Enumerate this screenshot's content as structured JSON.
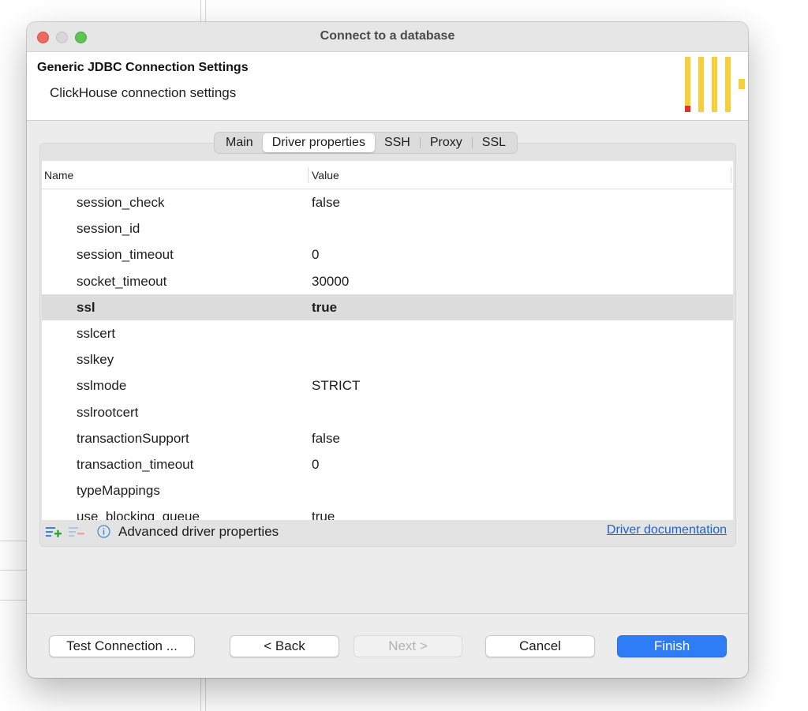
{
  "window": {
    "title": "Connect to a database"
  },
  "header": {
    "title": "Generic JDBC Connection Settings",
    "subtitle": "ClickHouse connection settings",
    "logo_icon": "clickhouse-logo",
    "logo_color": "#f5cf3c",
    "logo_accent": "#e2302c"
  },
  "tabs": [
    {
      "label": "Main",
      "active": false
    },
    {
      "label": "Driver properties",
      "active": true
    },
    {
      "label": "SSH",
      "active": false
    },
    {
      "label": "Proxy",
      "active": false
    },
    {
      "label": "SSL",
      "active": false
    }
  ],
  "table": {
    "columns": [
      "Name",
      "Value"
    ],
    "rows": [
      {
        "name": "session_check",
        "value": "false"
      },
      {
        "name": "session_id",
        "value": ""
      },
      {
        "name": "session_timeout",
        "value": "0"
      },
      {
        "name": "socket_timeout",
        "value": "30000"
      },
      {
        "name": "ssl",
        "value": "true"
      },
      {
        "name": "sslcert",
        "value": ""
      },
      {
        "name": "sslkey",
        "value": ""
      },
      {
        "name": "sslmode",
        "value": "STRICT"
      },
      {
        "name": "sslrootcert",
        "value": ""
      },
      {
        "name": "transactionSupport",
        "value": "false"
      },
      {
        "name": "transaction_timeout",
        "value": "0"
      },
      {
        "name": "typeMappings",
        "value": ""
      },
      {
        "name": "use_blocking_queue",
        "value": "true"
      }
    ],
    "selected_row": "ssl"
  },
  "properties_footer": {
    "add_icon": "add-property-icon",
    "remove_icon": "remove-property-icon",
    "info_icon": "info-icon",
    "advanced_label": "Advanced driver properties",
    "doc_link": "Driver documentation"
  },
  "buttons": {
    "test": "Test Connection ...",
    "back": "< Back",
    "next": "Next >",
    "cancel": "Cancel",
    "finish": "Finish"
  },
  "colors": {
    "primary": "#2e7cf6",
    "link": "#1a66cc",
    "selected_row": "#dcdcdc"
  }
}
